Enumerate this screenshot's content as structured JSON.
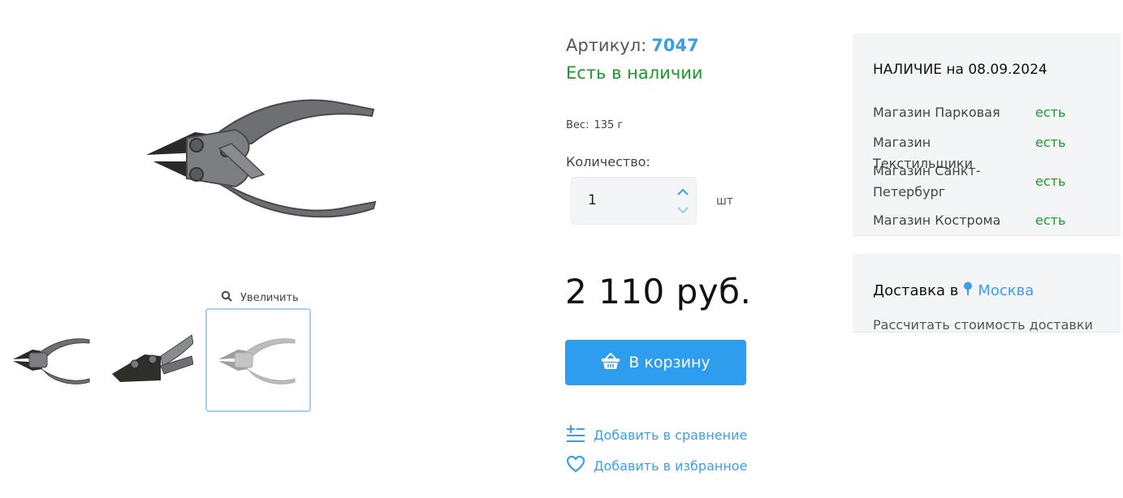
{
  "gallery": {
    "zoom_label": "Увеличить"
  },
  "product": {
    "article_label": "Артикул:",
    "article_number": "7047",
    "stock_status": "Есть в наличии",
    "weight_label": "Вес:",
    "weight_value": "135 г",
    "quantity_label": "Количество:",
    "quantity_value": "1",
    "unit": "шт",
    "price": "2 110 руб.",
    "cart_button": "В корзину",
    "compare_link": "Добавить в сравнение",
    "favorite_link": "Добавить в избранное"
  },
  "availability": {
    "title": "НАЛИЧИЕ на 08.09.2024",
    "stores": [
      {
        "name": "Магазин Парковая",
        "status": "есть"
      },
      {
        "name": "Магазин Текстильщики",
        "status": "есть"
      },
      {
        "name": "Магазин Санкт-Петербург",
        "status": "есть"
      },
      {
        "name": "Магазин Кострома",
        "status": "есть"
      }
    ]
  },
  "delivery": {
    "label": "Доставка в",
    "city": "Москва",
    "calc_link": "Рассчитать стоимость доставки"
  },
  "colors": {
    "accent": "#2e9ded",
    "in_stock": "#1b9a2a"
  }
}
